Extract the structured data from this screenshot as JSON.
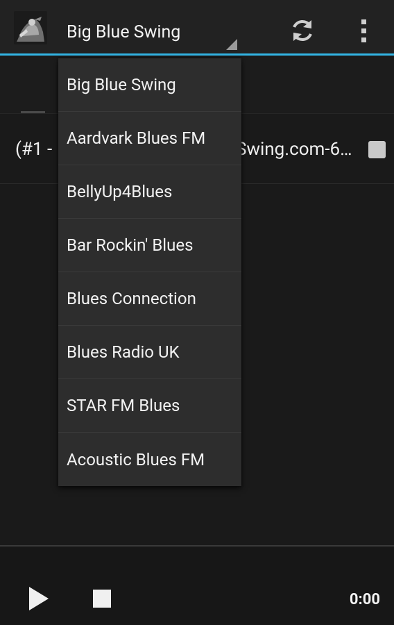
{
  "action_bar": {
    "selected_station": "Big Blue Swing",
    "icons": {
      "app": "app-logo-icon",
      "refresh": "refresh-icon",
      "overflow": "overflow-menu-icon"
    },
    "accent_color": "#33b5e5"
  },
  "track": {
    "text_left": "(#1 -",
    "text_right": "Swing.com-6…"
  },
  "dropdown": {
    "items": [
      {
        "label": "Big Blue Swing"
      },
      {
        "label": "Aardvark Blues FM"
      },
      {
        "label": "BellyUp4Blues"
      },
      {
        "label": "Bar Rockin' Blues"
      },
      {
        "label": "Blues Connection"
      },
      {
        "label": "Blues Radio UK"
      },
      {
        "label": "STAR FM Blues"
      },
      {
        "label": "Acoustic Blues FM"
      }
    ]
  },
  "player": {
    "time": "0:00",
    "icons": {
      "play": "play-icon",
      "stop": "stop-icon"
    }
  }
}
